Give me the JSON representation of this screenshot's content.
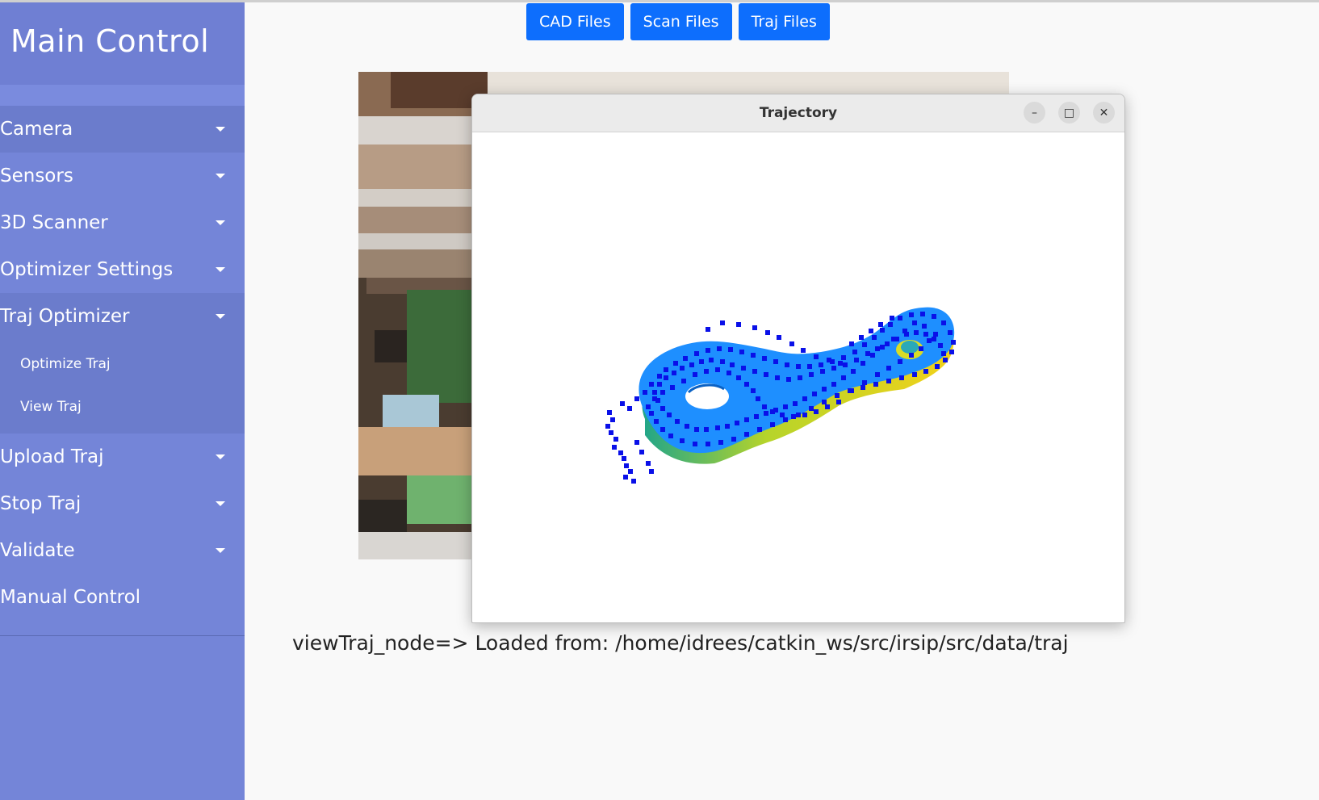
{
  "sidebar": {
    "title": "Main Control",
    "items": [
      {
        "label": "Camera",
        "style": "dark"
      },
      {
        "label": "Sensors",
        "style": "light"
      },
      {
        "label": "3D Scanner",
        "style": "light"
      },
      {
        "label": "Optimizer Settings",
        "style": "light"
      },
      {
        "label": "Traj Optimizer",
        "style": "dark"
      },
      {
        "label": "Upload Traj",
        "style": "light"
      },
      {
        "label": "Stop Traj",
        "style": "light"
      },
      {
        "label": "Validate",
        "style": "light"
      },
      {
        "label": "Manual Control",
        "style": "light"
      }
    ],
    "submenu": {
      "optimize_traj": "Optimize Traj",
      "view_traj": "View Traj"
    }
  },
  "top_buttons": {
    "cad": "CAD Files",
    "scan": "Scan Files",
    "traj": "Traj Files"
  },
  "trajectory_window": {
    "title": "Trajectory",
    "minimize_glyph": "–",
    "maximize_glyph": "□",
    "close_glyph": "✕"
  },
  "status": {
    "message": "viewTraj_node=> Loaded from: /home/idrees/catkin_ws/src/irsip/src/data/traj"
  },
  "colors": {
    "sidebar": "#7485d8",
    "button": "#0d6efd",
    "part": "#1e8fff",
    "points": "#0a10e8"
  }
}
